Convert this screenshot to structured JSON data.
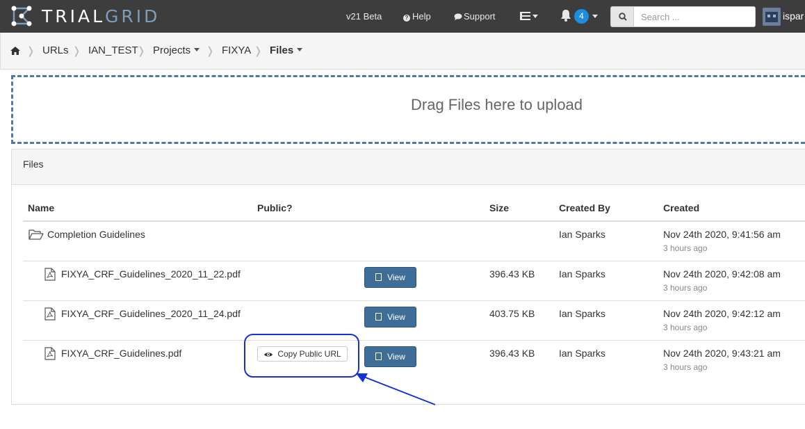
{
  "navbar": {
    "brand_part1": "TRIAL",
    "brand_part2": "GRID",
    "version": "v21 Beta",
    "help": "Help",
    "support": "Support",
    "notification_count": "4",
    "search_placeholder": "Search ...",
    "username": "ispar"
  },
  "breadcrumb": {
    "items": [
      "URLs",
      "IAN_TEST",
      "Projects",
      "FIXYA",
      "Files"
    ]
  },
  "dropzone": {
    "text": "Drag Files here to upload"
  },
  "panel": {
    "title": "Files"
  },
  "table": {
    "headers": [
      "Name",
      "Public?",
      "Size",
      "Created By",
      "Created"
    ],
    "rows": [
      {
        "name": "Completion Guidelines",
        "type": "folder",
        "size": "",
        "created_by": "Ian Sparks",
        "created": "Nov 24th 2020, 9:41:56 am",
        "ago": "3 hours ago"
      },
      {
        "name": "FIXYA_CRF_Guidelines_2020_11_22.pdf",
        "type": "pdf",
        "size": "396.43 KB",
        "created_by": "Ian Sparks",
        "created": "Nov 24th 2020, 9:42:08 am",
        "ago": "3 hours ago"
      },
      {
        "name": "FIXYA_CRF_Guidelines_2020_11_24.pdf",
        "type": "pdf",
        "size": "403.75 KB",
        "created_by": "Ian Sparks",
        "created": "Nov 24th 2020, 9:42:12 am",
        "ago": "3 hours ago"
      },
      {
        "name": "FIXYA_CRF_Guidelines.pdf",
        "type": "pdf",
        "size": "396.43 KB",
        "created_by": "Ian Sparks",
        "created": "Nov 24th 2020, 9:43:21 am",
        "ago": "3 hours ago",
        "public_url_label": "Copy Public URL"
      }
    ],
    "view_label": "View"
  },
  "colors": {
    "navbar": "#3d3d3d",
    "accent": "#1e8de0",
    "button": "#3e6e97",
    "callout": "#1430d8"
  }
}
